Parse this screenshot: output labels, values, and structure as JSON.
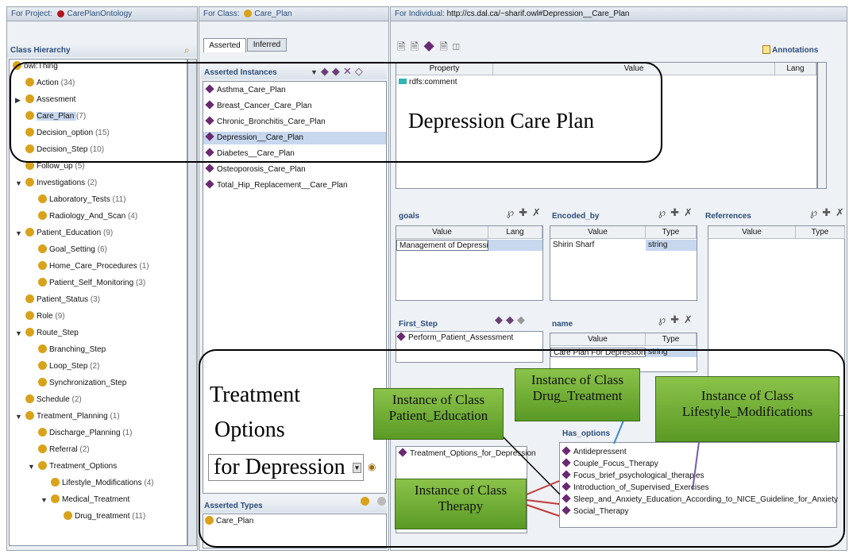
{
  "left": {
    "project_label": "For Project:",
    "project_name": "CarePlanOntology",
    "class_hierarchy_title": "Class Hierarchy",
    "tree": [
      {
        "label": "owl:Thing",
        "count": ""
      },
      {
        "label": "Action",
        "count": "(34)"
      },
      {
        "label": "Assesment",
        "count": ""
      },
      {
        "label": "Care_Plan",
        "count": "(7)"
      },
      {
        "label": "Decision_option",
        "count": "(15)"
      },
      {
        "label": "Decision_Step",
        "count": "(10)"
      },
      {
        "label": "Follow_up",
        "count": "(5)"
      },
      {
        "label": "Investigations",
        "count": "(2)"
      },
      {
        "label": "Laboratory_Tests",
        "count": "(11)"
      },
      {
        "label": "Radiology_And_Scan",
        "count": "(4)"
      },
      {
        "label": "Patient_Education",
        "count": "(9)"
      },
      {
        "label": "Goal_Setting",
        "count": "(6)"
      },
      {
        "label": "Home_Care_Procedures",
        "count": "(1)"
      },
      {
        "label": "Patient_Self_Monitoring",
        "count": "(3)"
      },
      {
        "label": "Patient_Status",
        "count": "(3)"
      },
      {
        "label": "Role",
        "count": "(9)"
      },
      {
        "label": "Route_Step",
        "count": ""
      },
      {
        "label": "Branching_Step",
        "count": ""
      },
      {
        "label": "Loop_Step",
        "count": "(2)"
      },
      {
        "label": "Synchronization_Step",
        "count": ""
      },
      {
        "label": "Schedule",
        "count": "(2)"
      },
      {
        "label": "Treatment_Planning",
        "count": "(1)"
      },
      {
        "label": "Discharge_Planning",
        "count": "(1)"
      },
      {
        "label": "Referral",
        "count": "(2)"
      },
      {
        "label": "Treatment_Options",
        "count": ""
      },
      {
        "label": "Lifestyle_Modifications",
        "count": "(4)"
      },
      {
        "label": "Medical_Treatment",
        "count": ""
      },
      {
        "label": "Drug_treatment",
        "count": "(11)"
      }
    ]
  },
  "middle": {
    "class_label": "For Class:",
    "class_name": "Care_Plan",
    "tabs": [
      "Asserted",
      "Inferred"
    ],
    "asserted_instances_title": "Asserted Instances",
    "instances": [
      "Asthma_Care_Plan",
      "Breast_Cancer_Care_Plan",
      "Chronic_Bronchitis_Care_Plan",
      "Depression__Care_Plan",
      "Diabetes__Care_Plan",
      "Osteoporosis_Care_Plan",
      "Total_Hip_Replacement__Care_Plan"
    ],
    "asserted_types_title": "Asserted Types",
    "types": [
      "Care_Plan"
    ]
  },
  "right": {
    "individual_label": "For Individual:",
    "individual_uri": "http://cs.dal.ca/~sharif.owl#Depression__Care_Plan",
    "annotations_label": "Annotations",
    "annotation_headers": [
      "Property",
      "Value",
      "Lang"
    ],
    "annotation_property": "rdfs:comment",
    "goals": {
      "title": "goals",
      "headers": [
        "Value",
        "Lang"
      ],
      "value": "Management of DepressionI"
    },
    "encoded_by": {
      "title": "Encoded_by",
      "headers": [
        "Value",
        "Type"
      ],
      "value": "Shirin Sharf",
      "type": "string"
    },
    "references": {
      "title": "Referrences",
      "headers": [
        "Value",
        "Type"
      ]
    },
    "first_step": {
      "title": "First_Step",
      "value": "Perform_Patient_Assessment"
    },
    "name": {
      "title": "name",
      "headers": [
        "Value",
        "Type"
      ],
      "value": "Care Plan For Depression",
      "type": "string"
    },
    "has_options": {
      "title": "Has_options",
      "items": [
        "Antidepressent",
        "Couple_Focus_Therapy",
        "Focus_brief_psychological_therapies",
        "Introduction_of_Supervised_Exercises",
        "Sleep_and_Anxiety_Education_According_to_NICE_Guideline_for_Anxiety",
        "Social_Therapy"
      ]
    },
    "treatment_options_item": "Treatment_Options_for_Depression"
  },
  "overlay": {
    "depression_care_plan": "Depression Care Plan",
    "treatment_line1": "Treatment",
    "treatment_line2": "Options",
    "treatment_line3": "for Depression",
    "callout_patient_education_1": "Instance of Class",
    "callout_patient_education_2": "Patient_Education",
    "callout_drug_1": "Instance of Class",
    "callout_drug_2": "Drug_Treatment",
    "callout_lifestyle_1": "Instance of Class",
    "callout_lifestyle_2": "Lifestyle_Modifications",
    "callout_therapy_1": "Instance of Class",
    "callout_therapy_2": "Therapy"
  },
  "colors": {
    "callout_green": "#6fb133",
    "header_blue": "#2c4d7a",
    "instance_purple": "#6a2a70",
    "class_gold": "#d9a21b"
  }
}
